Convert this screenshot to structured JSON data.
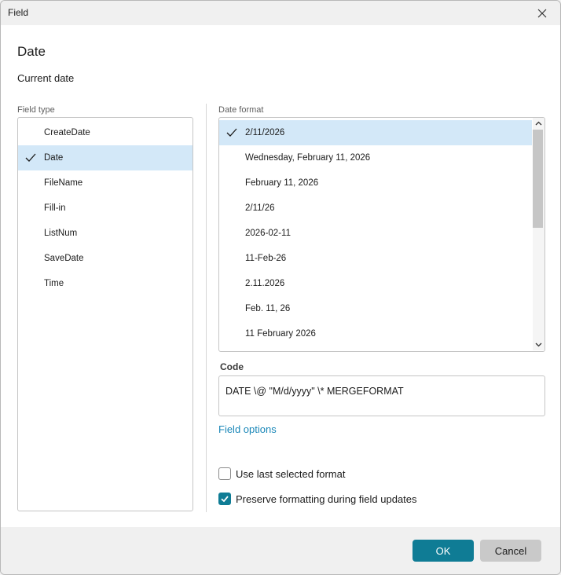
{
  "window": {
    "title": "Field"
  },
  "header": {
    "heading": "Date",
    "subheading": "Current date"
  },
  "field_type": {
    "label": "Field type",
    "items": [
      {
        "label": "CreateDate",
        "selected": false
      },
      {
        "label": "Date",
        "selected": true
      },
      {
        "label": "FileName",
        "selected": false
      },
      {
        "label": "Fill-in",
        "selected": false
      },
      {
        "label": "ListNum",
        "selected": false
      },
      {
        "label": "SaveDate",
        "selected": false
      },
      {
        "label": "Time",
        "selected": false
      }
    ]
  },
  "date_format": {
    "label": "Date format",
    "items": [
      {
        "label": "2/11/2026",
        "selected": true
      },
      {
        "label": "Wednesday, February 11, 2026",
        "selected": false
      },
      {
        "label": "February 11, 2026",
        "selected": false
      },
      {
        "label": "2/11/26",
        "selected": false
      },
      {
        "label": "2026-02-11",
        "selected": false
      },
      {
        "label": "11-Feb-26",
        "selected": false
      },
      {
        "label": "2.11.2026",
        "selected": false
      },
      {
        "label": "Feb. 11, 26",
        "selected": false
      },
      {
        "label": "11 February 2026",
        "selected": false
      }
    ]
  },
  "code": {
    "label": "Code",
    "value": "DATE \\@ \"M/d/yyyy\" \\* MERGEFORMAT"
  },
  "field_options_link": "Field options",
  "options": {
    "use_last_format": {
      "label": "Use last selected format",
      "checked": false
    },
    "preserve_formatting": {
      "label": "Preserve formatting during field updates",
      "checked": true
    }
  },
  "buttons": {
    "ok": "OK",
    "cancel": "Cancel"
  },
  "colors": {
    "accent": "#0f7c95",
    "selection": "#d3e8f8",
    "link": "#1a87b8"
  }
}
